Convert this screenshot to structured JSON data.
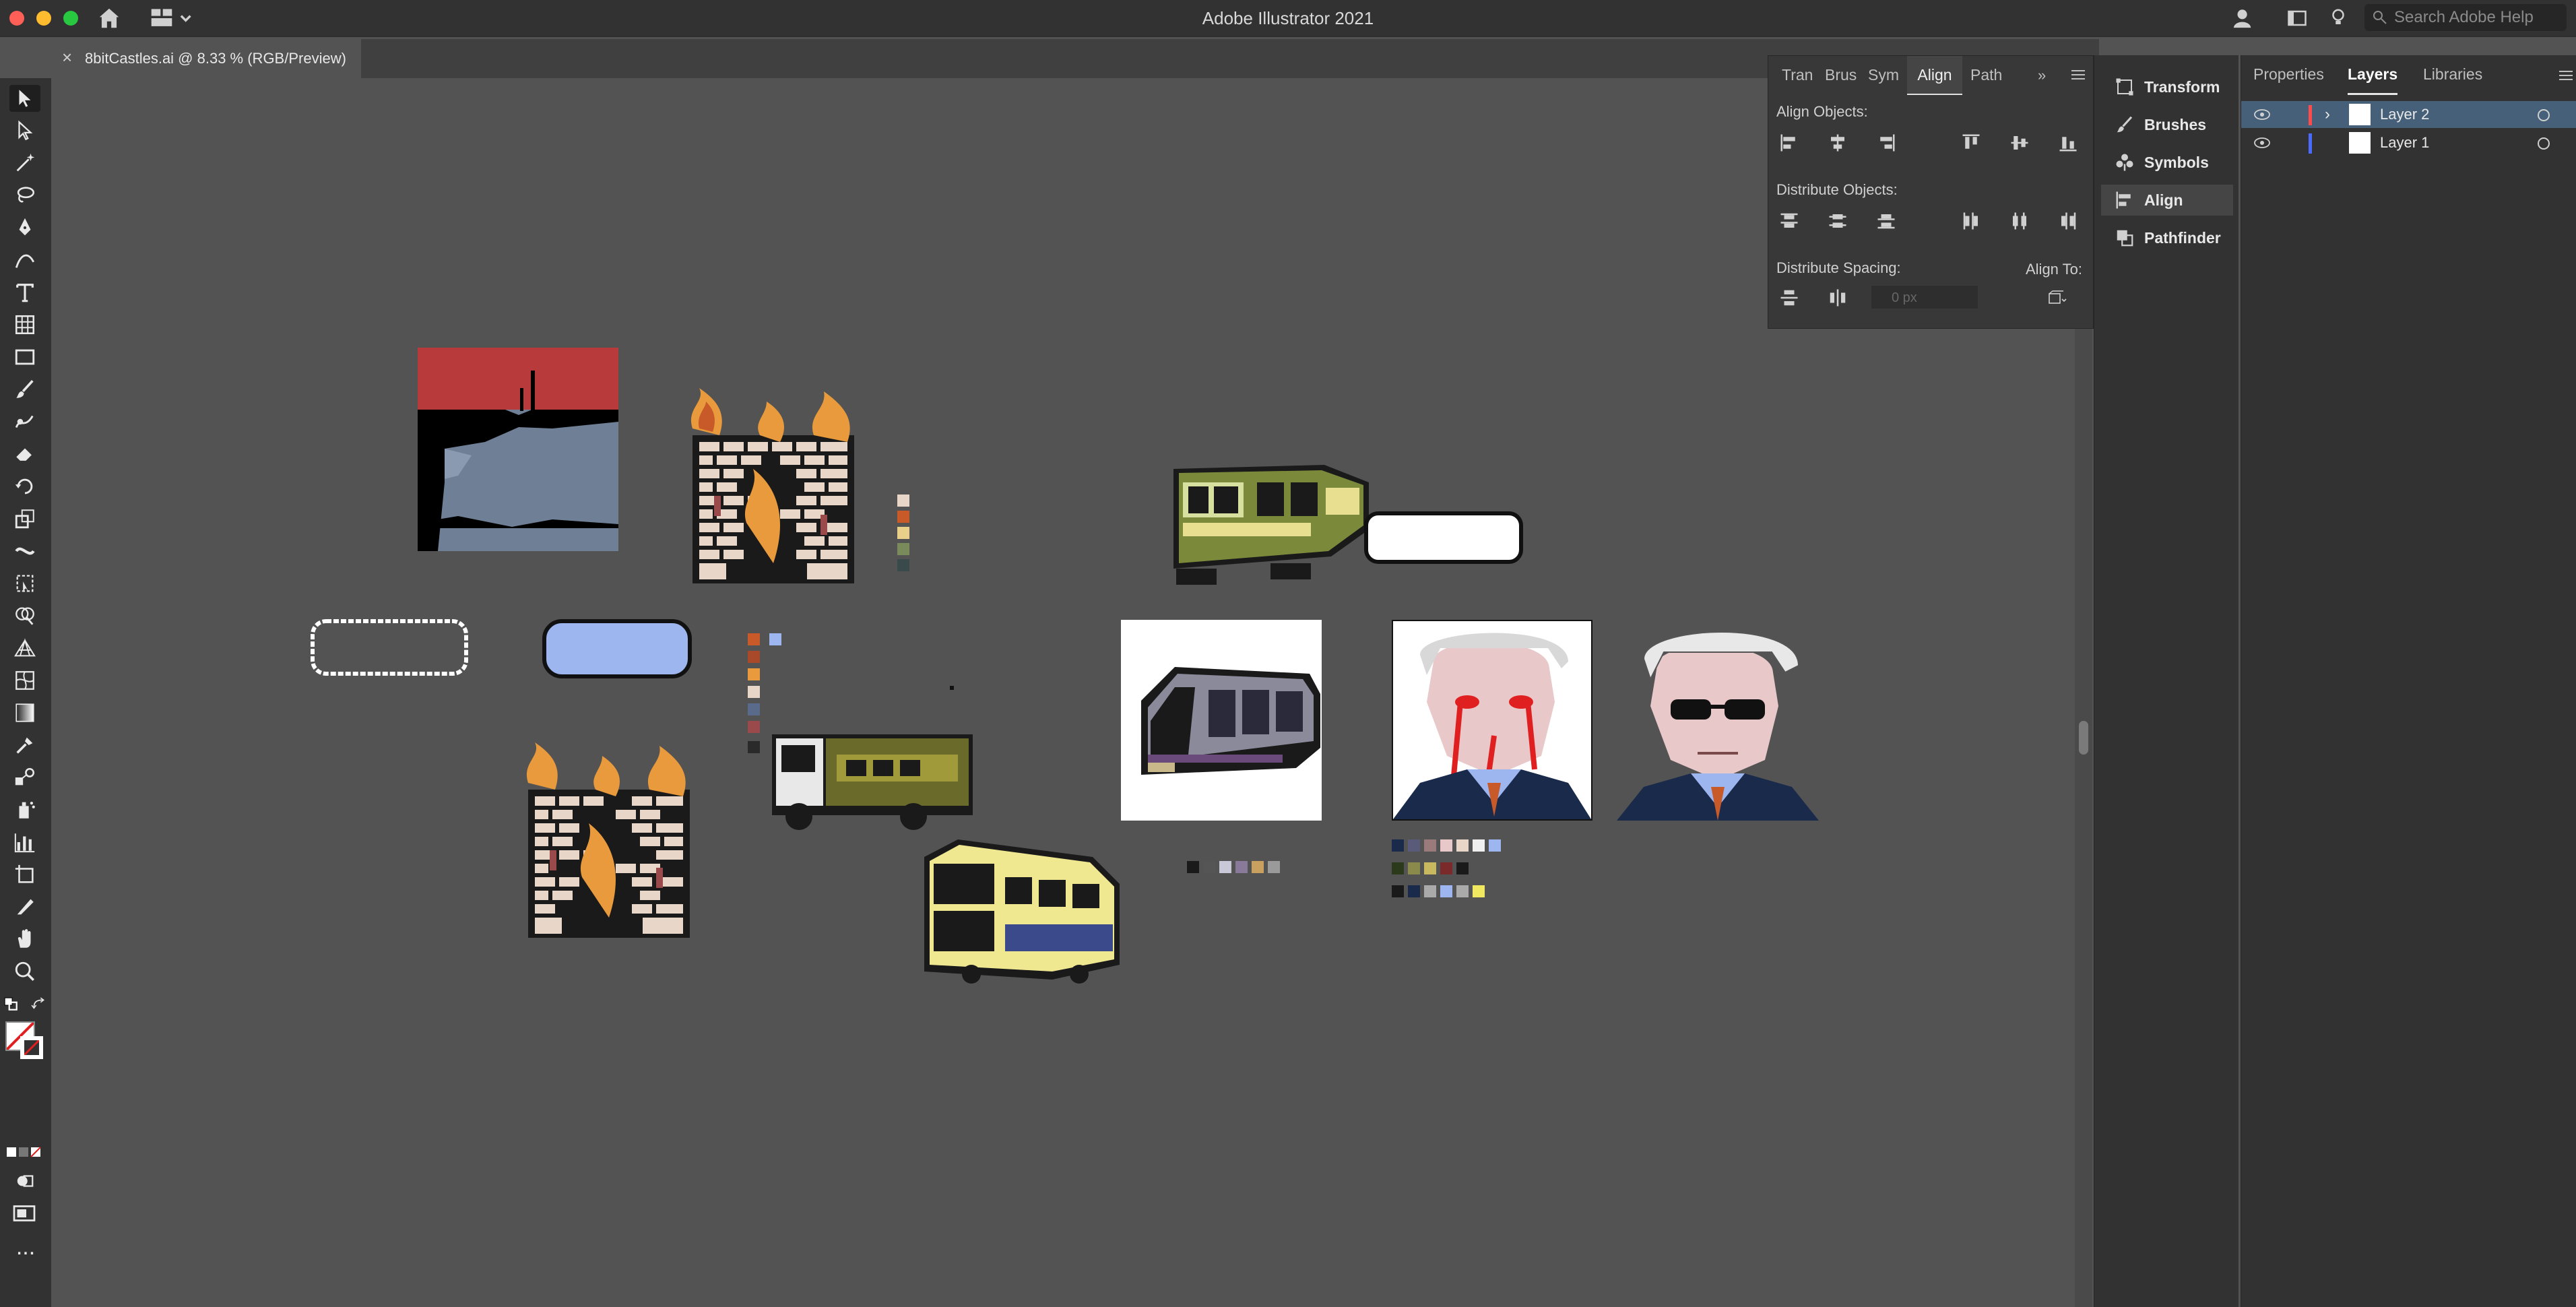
{
  "window": {
    "title": "Adobe Illustrator 2021"
  },
  "search": {
    "placeholder": "Search Adobe Help"
  },
  "document": {
    "tab_label": "8bitCastles.ai @ 8.33 % (RGB/Preview)"
  },
  "toolbar": {
    "tools": [
      "selection-tool",
      "direct-selection-tool",
      "magic-wand-tool",
      "lasso-tool",
      "pen-tool",
      "curvature-tool",
      "type-tool",
      "table-tool",
      "rectangle-tool",
      "paintbrush-tool",
      "shaper-tool",
      "eraser-tool",
      "rotate-tool",
      "scale-tool",
      "width-tool",
      "free-transform-tool",
      "shape-builder-tool",
      "perspective-grid-tool",
      "mesh-tool",
      "gradient-tool",
      "eyedropper-tool",
      "blend-tool",
      "symbol-sprayer-tool",
      "column-graph-tool",
      "artboard-tool",
      "slice-tool",
      "hand-tool",
      "zoom-tool"
    ],
    "more_label": "..."
  },
  "align_panel": {
    "tabs": [
      "Tran",
      "Brus",
      "Sym",
      "Align",
      "Path"
    ],
    "active_tab": "Align",
    "align_objects_label": "Align Objects:",
    "distribute_objects_label": "Distribute Objects:",
    "distribute_spacing_label": "Distribute Spacing:",
    "align_to_label": "Align To:",
    "spacing_value": "0 px"
  },
  "icon_panel": {
    "items": [
      {
        "label": "Transform",
        "icon": "transform-icon"
      },
      {
        "label": "Brushes",
        "icon": "brushes-icon"
      },
      {
        "label": "Symbols",
        "icon": "symbols-icon"
      },
      {
        "label": "Align",
        "icon": "align-icon"
      },
      {
        "label": "Pathfinder",
        "icon": "pathfinder-icon"
      }
    ],
    "active": "Align"
  },
  "layers_panel": {
    "tabs": [
      "Properties",
      "Layers",
      "Libraries"
    ],
    "active_tab": "Layers",
    "layers": [
      {
        "name": "Layer 2",
        "color": "#ff4b4b",
        "selected": true
      },
      {
        "name": "Layer 1",
        "color": "#4b6bff",
        "selected": false
      }
    ]
  },
  "colors": {
    "accent": "#46607a",
    "canvas": "#535353",
    "panel": "#323232"
  },
  "artwork": [
    "red-sky-landscape",
    "burning-castle",
    "green-tram",
    "white-speech-bubble",
    "empty-speech-bubble",
    "blue-speech-bubble",
    "burning-castle-2",
    "olive-truck",
    "modern-tram-artboard",
    "yellow-bus",
    "bloody-old-man-portrait",
    "old-man-sunglasses-portrait"
  ]
}
